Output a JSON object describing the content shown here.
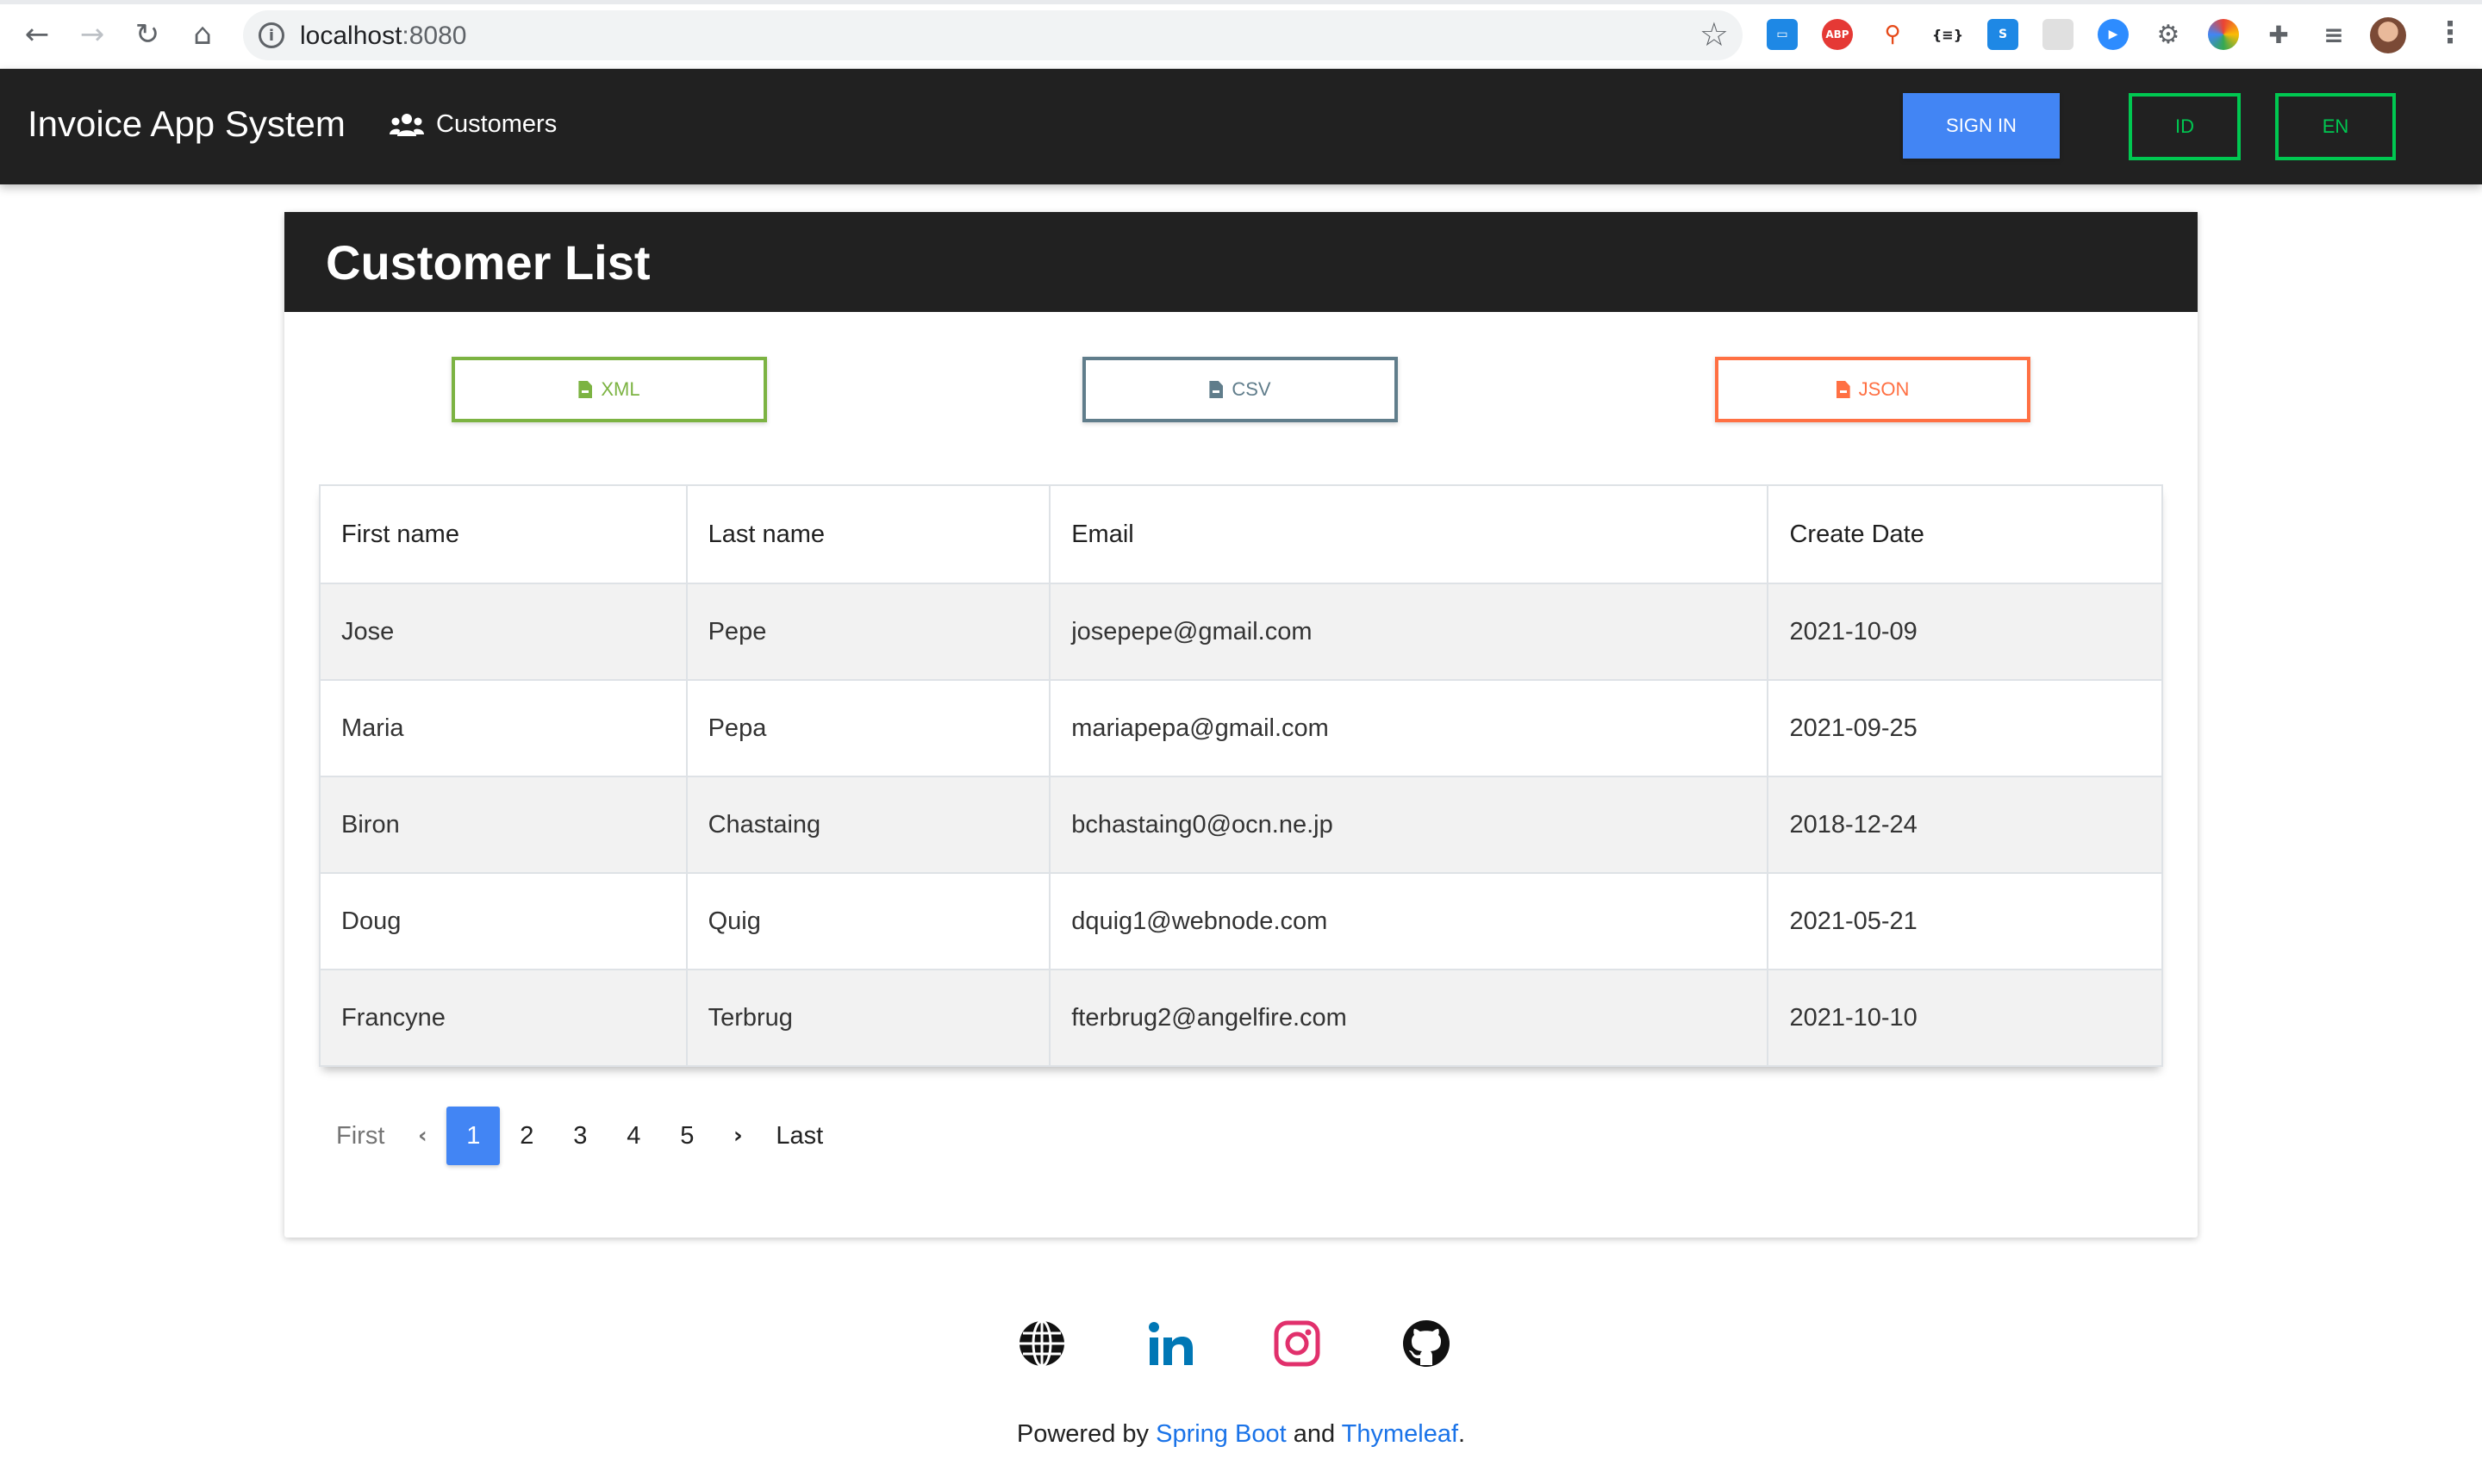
{
  "browser": {
    "url_host": "localhost",
    "url_port": ":8080"
  },
  "navbar": {
    "brand": "Invoice App System",
    "customers_link": "Customers",
    "sign_in": "SIGN IN",
    "lang_id": "ID",
    "lang_en": "EN"
  },
  "card": {
    "title": "Customer List",
    "exports": {
      "xml": "XML",
      "csv": "CSV",
      "json": "JSON"
    },
    "table": {
      "headers": [
        "First name",
        "Last name",
        "Email",
        "Create Date"
      ],
      "rows": [
        [
          "Jose",
          "Pepe",
          "josepepe@gmail.com",
          "2021-10-09"
        ],
        [
          "Maria",
          "Pepa",
          "mariapepa@gmail.com",
          "2021-09-25"
        ],
        [
          "Biron",
          "Chastaing",
          "bchastaing0@ocn.ne.jp",
          "2018-12-24"
        ],
        [
          "Doug",
          "Quig",
          "dquig1@webnode.com",
          "2021-05-21"
        ],
        [
          "Francyne",
          "Terbrug",
          "fterbrug2@angelfire.com",
          "2021-10-10"
        ]
      ]
    },
    "pagination": {
      "first": "First",
      "prev": "‹",
      "pages": [
        "1",
        "2",
        "3",
        "4",
        "5"
      ],
      "current_page": "1",
      "next": "›",
      "last": "Last"
    }
  },
  "footer": {
    "icons": [
      "globe-icon",
      "linkedin-icon",
      "instagram-icon",
      "github-icon"
    ],
    "powered_by": "Powered by",
    "spring_boot": "Spring Boot",
    "and": "and",
    "thymeleaf": "Thymeleaf",
    "period": "."
  },
  "colors": {
    "navbar_bg": "#212121",
    "primary": "#4285f4",
    "success": "#00c851",
    "xml": "#7cb342",
    "csv": "#607d8b",
    "json": "#ff7043",
    "linkedin": "#0077b5",
    "instagram": "#e1306c",
    "link": "#1a73e8"
  }
}
